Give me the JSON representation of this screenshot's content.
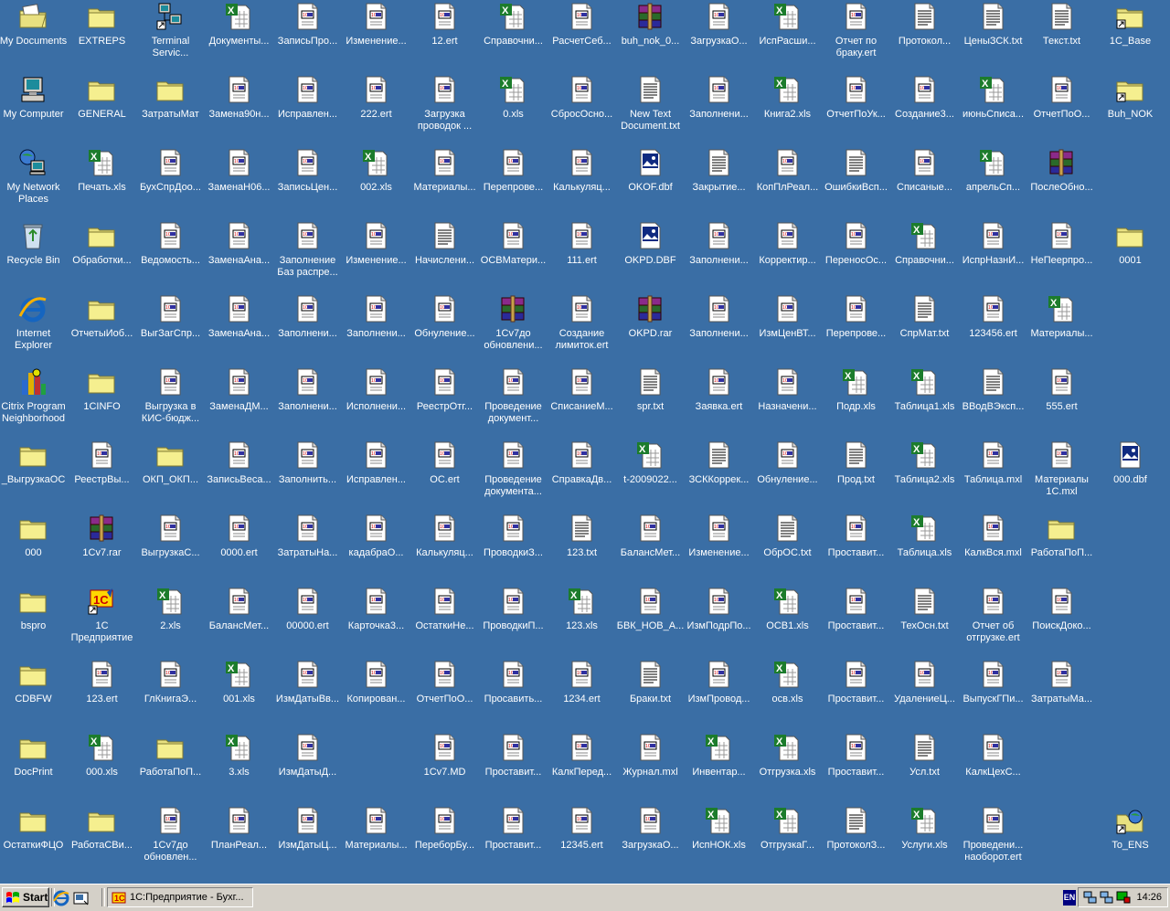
{
  "desktop": {
    "columns": [
      [
        {
          "label": "My Documents",
          "icon": "my-documents"
        },
        {
          "label": "My Computer",
          "icon": "my-computer"
        },
        {
          "label": "My Network Places",
          "icon": "network-places"
        },
        {
          "label": "Recycle Bin",
          "icon": "recycle-bin"
        },
        {
          "label": "Internet Explorer",
          "icon": "internet-explorer"
        },
        {
          "label": "Citrix Program Neighborhood",
          "icon": "citrix"
        },
        {
          "label": "_ВыгрузкаОС",
          "icon": "folder"
        },
        {
          "label": "000",
          "icon": "folder"
        },
        {
          "label": "bspro",
          "icon": "folder"
        },
        {
          "label": "CDBFW",
          "icon": "folder"
        },
        {
          "label": "DocPrint",
          "icon": "folder"
        },
        {
          "label": "ОстаткиФЦО",
          "icon": "folder"
        }
      ],
      [
        {
          "label": "EXTREPS",
          "icon": "folder"
        },
        {
          "label": "GENERAL",
          "icon": "folder"
        },
        {
          "label": "Печать.xls",
          "icon": "excel"
        },
        {
          "label": "Обработки...",
          "icon": "folder"
        },
        {
          "label": "ОтчетыИоб...",
          "icon": "folder"
        },
        {
          "label": "1CINFO",
          "icon": "folder"
        },
        {
          "label": "РеестрВы...",
          "icon": "ert"
        },
        {
          "label": "1Cv7.rar",
          "icon": "rar"
        },
        {
          "label": "1С Предприятие",
          "icon": "1c-shortcut"
        },
        {
          "label": "123.ert",
          "icon": "ert"
        },
        {
          "label": "000.xls",
          "icon": "excel"
        },
        {
          "label": "РаботаСВи...",
          "icon": "folder"
        }
      ],
      [
        {
          "label": "Terminal Servic...",
          "icon": "terminal-services"
        },
        {
          "label": "ЗатратыМат",
          "icon": "folder"
        },
        {
          "label": "БухСпрДоо...",
          "icon": "ert"
        },
        {
          "label": "Ведомость...",
          "icon": "ert"
        },
        {
          "label": "ВыгЗагСпр...",
          "icon": "ert"
        },
        {
          "label": "Выгрузка в КИС-бюдж...",
          "icon": "ert"
        },
        {
          "label": "ОКП_ОКП...",
          "icon": "folder"
        },
        {
          "label": "ВыгрузкаС...",
          "icon": "ert"
        },
        {
          "label": "2.xls",
          "icon": "excel"
        },
        {
          "label": "ГлКнигаЭ...",
          "icon": "ert"
        },
        {
          "label": "РаботаПоП...",
          "icon": "folder"
        },
        {
          "label": "1Cv7до обновлен...",
          "icon": "ert"
        }
      ],
      [
        {
          "label": "Документы...",
          "icon": "excel"
        },
        {
          "label": "Замена90н...",
          "icon": "ert"
        },
        {
          "label": "ЗаменаН06...",
          "icon": "ert"
        },
        {
          "label": "ЗаменаАна...",
          "icon": "ert"
        },
        {
          "label": "ЗаменаАна...",
          "icon": "ert"
        },
        {
          "label": "ЗаменаДМ...",
          "icon": "ert"
        },
        {
          "label": "ЗаписьВеса...",
          "icon": "ert"
        },
        {
          "label": "0000.ert",
          "icon": "ert"
        },
        {
          "label": "БалансМет...",
          "icon": "ert"
        },
        {
          "label": "001.xls",
          "icon": "excel"
        },
        {
          "label": "3.xls",
          "icon": "excel"
        },
        {
          "label": "ПланРеал...",
          "icon": "ert"
        }
      ],
      [
        {
          "label": "ЗаписьПро...",
          "icon": "ert"
        },
        {
          "label": "Исправлен...",
          "icon": "ert"
        },
        {
          "label": "ЗаписьЦен...",
          "icon": "ert"
        },
        {
          "label": "Заполнение Баз распре...",
          "icon": "ert"
        },
        {
          "label": "Заполнени...",
          "icon": "ert"
        },
        {
          "label": "Заполнени...",
          "icon": "ert"
        },
        {
          "label": "Заполнить...",
          "icon": "ert"
        },
        {
          "label": "ЗатратыНа...",
          "icon": "ert"
        },
        {
          "label": "00000.ert",
          "icon": "ert"
        },
        {
          "label": "ИзмДатыВв...",
          "icon": "ert"
        },
        {
          "label": "ИзмДатыД...",
          "icon": "ert"
        },
        {
          "label": "ИзмДатыЦ...",
          "icon": "ert"
        }
      ],
      [
        {
          "label": "Изменение...",
          "icon": "ert"
        },
        {
          "label": "222.ert",
          "icon": "ert"
        },
        {
          "label": "002.xls",
          "icon": "excel"
        },
        {
          "label": "Изменение...",
          "icon": "ert"
        },
        {
          "label": "Заполнени...",
          "icon": "ert"
        },
        {
          "label": "Исполнени...",
          "icon": "ert"
        },
        {
          "label": "Исправлен...",
          "icon": "ert"
        },
        {
          "label": "кадабраО...",
          "icon": "ert"
        },
        {
          "label": "Карточка3...",
          "icon": "ert"
        },
        {
          "label": "Копирован...",
          "icon": "ert"
        },
        null,
        {
          "label": "Материалы...",
          "icon": "ert"
        }
      ],
      [
        {
          "label": "12.ert",
          "icon": "ert"
        },
        {
          "label": "Загрузка проводок ...",
          "icon": "ert"
        },
        {
          "label": "Материалы...",
          "icon": "ert"
        },
        {
          "label": "Начислени...",
          "icon": "text"
        },
        {
          "label": "Обнуление...",
          "icon": "ert"
        },
        {
          "label": "РеестрОтг...",
          "icon": "ert"
        },
        {
          "label": "ОС.ert",
          "icon": "ert"
        },
        {
          "label": "Калькуляц...",
          "icon": "ert"
        },
        {
          "label": "ОстаткиНе...",
          "icon": "ert"
        },
        {
          "label": "ОтчетПоО...",
          "icon": "ert"
        },
        {
          "label": "1Cv7.MD",
          "icon": "ert"
        },
        {
          "label": "ПереборБу...",
          "icon": "ert"
        }
      ],
      [
        {
          "label": "Справочни...",
          "icon": "excel"
        },
        {
          "label": "0.xls",
          "icon": "excel"
        },
        {
          "label": "Перепрове...",
          "icon": "ert"
        },
        {
          "label": "ОСВМатери...",
          "icon": "ert"
        },
        {
          "label": "1Cv7до обновлени...",
          "icon": "rar"
        },
        {
          "label": "Проведение документ...",
          "icon": "ert"
        },
        {
          "label": "Проведение документа...",
          "icon": "ert"
        },
        {
          "label": "ПроводкиЗ...",
          "icon": "ert"
        },
        {
          "label": "ПроводкиП...",
          "icon": "ert"
        },
        {
          "label": "Просавить...",
          "icon": "ert"
        },
        {
          "label": "Проставит...",
          "icon": "ert"
        },
        {
          "label": "Проставит...",
          "icon": "ert"
        }
      ],
      [
        {
          "label": "РасчетСеб...",
          "icon": "ert"
        },
        {
          "label": "СбросОсно...",
          "icon": "ert"
        },
        {
          "label": "Калькуляц...",
          "icon": "ert"
        },
        {
          "label": "111.ert",
          "icon": "ert"
        },
        {
          "label": "Создание лимиток.ert",
          "icon": "ert"
        },
        {
          "label": "СписаниеМ...",
          "icon": "ert"
        },
        {
          "label": "СправкаДв...",
          "icon": "ert"
        },
        {
          "label": "123.txt",
          "icon": "text"
        },
        {
          "label": "123.xls",
          "icon": "excel"
        },
        {
          "label": "1234.ert",
          "icon": "ert"
        },
        {
          "label": "КалкПеред...",
          "icon": "ert"
        },
        {
          "label": "12345.ert",
          "icon": "ert"
        }
      ],
      [
        {
          "label": "buh_nok_0...",
          "icon": "rar"
        },
        {
          "label": "New Text Document.txt",
          "icon": "text"
        },
        {
          "label": "OKOF.dbf",
          "icon": "dbf"
        },
        {
          "label": "OKPD.DBF",
          "icon": "dbf"
        },
        {
          "label": "OKPD.rar",
          "icon": "rar"
        },
        {
          "label": "spr.txt",
          "icon": "text"
        },
        {
          "label": "t-2009022...",
          "icon": "excel"
        },
        {
          "label": "БалансМет...",
          "icon": "ert"
        },
        {
          "label": "БВК_НОВ_А...",
          "icon": "ert"
        },
        {
          "label": "Браки.txt",
          "icon": "text"
        },
        {
          "label": "Журнал.mxl",
          "icon": "ert"
        },
        {
          "label": "ЗагрузкаО...",
          "icon": "ert"
        }
      ],
      [
        {
          "label": "ЗагрузкаО...",
          "icon": "ert"
        },
        {
          "label": "Заполнени...",
          "icon": "ert"
        },
        {
          "label": "Закрытие...",
          "icon": "text"
        },
        {
          "label": "Заполнени...",
          "icon": "ert"
        },
        {
          "label": "Заполнени...",
          "icon": "ert"
        },
        {
          "label": "Заявка.ert",
          "icon": "ert"
        },
        {
          "label": "ЗСККоррек...",
          "icon": "text"
        },
        {
          "label": "Изменение...",
          "icon": "ert"
        },
        {
          "label": "ИзмПодрПо...",
          "icon": "ert"
        },
        {
          "label": "ИзмПровод...",
          "icon": "ert"
        },
        {
          "label": "Инвентар...",
          "icon": "excel"
        },
        {
          "label": "ИспНОК.xls",
          "icon": "excel"
        }
      ],
      [
        {
          "label": "ИспРасши...",
          "icon": "excel"
        },
        {
          "label": "Книга2.xls",
          "icon": "excel"
        },
        {
          "label": "КопПлРеал...",
          "icon": "ert"
        },
        {
          "label": "Корректир...",
          "icon": "ert"
        },
        {
          "label": "ИзмЦенВТ...",
          "icon": "ert"
        },
        {
          "label": "Назначени...",
          "icon": "ert"
        },
        {
          "label": "Обнуление...",
          "icon": "ert"
        },
        {
          "label": "ОбрОС.txt",
          "icon": "text"
        },
        {
          "label": "ОСВ1.xls",
          "icon": "excel"
        },
        {
          "label": "осв.xls",
          "icon": "excel"
        },
        {
          "label": "Отгрузка.xls",
          "icon": "excel"
        },
        {
          "label": "ОтгрузкаГ...",
          "icon": "excel"
        }
      ],
      [
        {
          "label": "Отчет по браку.ert",
          "icon": "ert"
        },
        {
          "label": "ОтчетПоУк...",
          "icon": "ert"
        },
        {
          "label": "ОшибкиВсп...",
          "icon": "text"
        },
        {
          "label": "ПереносОс...",
          "icon": "ert"
        },
        {
          "label": "Перепрове...",
          "icon": "ert"
        },
        {
          "label": "Подр.xls",
          "icon": "excel"
        },
        {
          "label": "Прод.txt",
          "icon": "text"
        },
        {
          "label": "Проставит...",
          "icon": "ert"
        },
        {
          "label": "Проставит...",
          "icon": "ert"
        },
        {
          "label": "Проставит...",
          "icon": "ert"
        },
        {
          "label": "Проставит...",
          "icon": "ert"
        },
        {
          "label": "ПротоколЗ...",
          "icon": "text"
        }
      ],
      [
        {
          "label": "Протокол...",
          "icon": "text"
        },
        {
          "label": "Создание3...",
          "icon": "ert"
        },
        {
          "label": "Списаные...",
          "icon": "ert"
        },
        {
          "label": "Справочни...",
          "icon": "excel"
        },
        {
          "label": "СпрМат.txt",
          "icon": "text"
        },
        {
          "label": "Таблица1.xls",
          "icon": "excel"
        },
        {
          "label": "Таблица2.xls",
          "icon": "excel"
        },
        {
          "label": "Таблица.xls",
          "icon": "excel"
        },
        {
          "label": "ТехОсн.txt",
          "icon": "text"
        },
        {
          "label": "УдалениеЦ...",
          "icon": "ert"
        },
        {
          "label": "Усл.txt",
          "icon": "text"
        },
        {
          "label": "Услуги.xls",
          "icon": "excel"
        }
      ],
      [
        {
          "label": "ЦеныЗСК.txt",
          "icon": "text"
        },
        {
          "label": "июньСписа...",
          "icon": "excel"
        },
        {
          "label": "апрельСп...",
          "icon": "excel"
        },
        {
          "label": "ИспрНазнИ...",
          "icon": "ert"
        },
        {
          "label": "123456.ert",
          "icon": "ert"
        },
        {
          "label": "ВВодВЭксп...",
          "icon": "text"
        },
        {
          "label": "Таблица.mxl",
          "icon": "ert"
        },
        {
          "label": "КалкВся.mxl",
          "icon": "ert"
        },
        {
          "label": "Отчет об отгрузке.ert",
          "icon": "ert"
        },
        {
          "label": "ВыпускГПи...",
          "icon": "ert"
        },
        {
          "label": "КалкЦехС...",
          "icon": "ert"
        },
        {
          "label": "Проведени... наоборот.ert",
          "icon": "ert"
        }
      ],
      [
        {
          "label": "Текст.txt",
          "icon": "text"
        },
        {
          "label": "ОтчетПоО...",
          "icon": "ert"
        },
        {
          "label": "ПослеОбно...",
          "icon": "rar"
        },
        {
          "label": "НеПеерпро...",
          "icon": "ert"
        },
        {
          "label": "Материалы...",
          "icon": "excel"
        },
        {
          "label": "555.ert",
          "icon": "ert"
        },
        {
          "label": "Материалы 1С.mxl",
          "icon": "ert"
        },
        {
          "label": "РаботаПоП...",
          "icon": "folder"
        },
        {
          "label": "ПоискДоко...",
          "icon": "ert"
        },
        {
          "label": "ЗатратыМа...",
          "icon": "ert"
        },
        null,
        null
      ],
      [
        {
          "label": "1C_Base",
          "icon": "folder-shortcut"
        },
        {
          "label": "Buh_NOK",
          "icon": "folder-shortcut"
        },
        null,
        {
          "label": "0001",
          "icon": "folder"
        },
        null,
        null,
        {
          "label": "000.dbf",
          "icon": "dbf"
        },
        null,
        null,
        null,
        null,
        {
          "label": "To_ENS",
          "icon": "network-shortcut"
        }
      ]
    ]
  },
  "taskbar": {
    "start_label": "Start",
    "task_label": "1С:Предприятие - Бухг...",
    "language": "EN",
    "clock": "14:26"
  },
  "colors": {
    "desktop": "#3a6ea5",
    "taskbar": "#d4d0c8"
  }
}
